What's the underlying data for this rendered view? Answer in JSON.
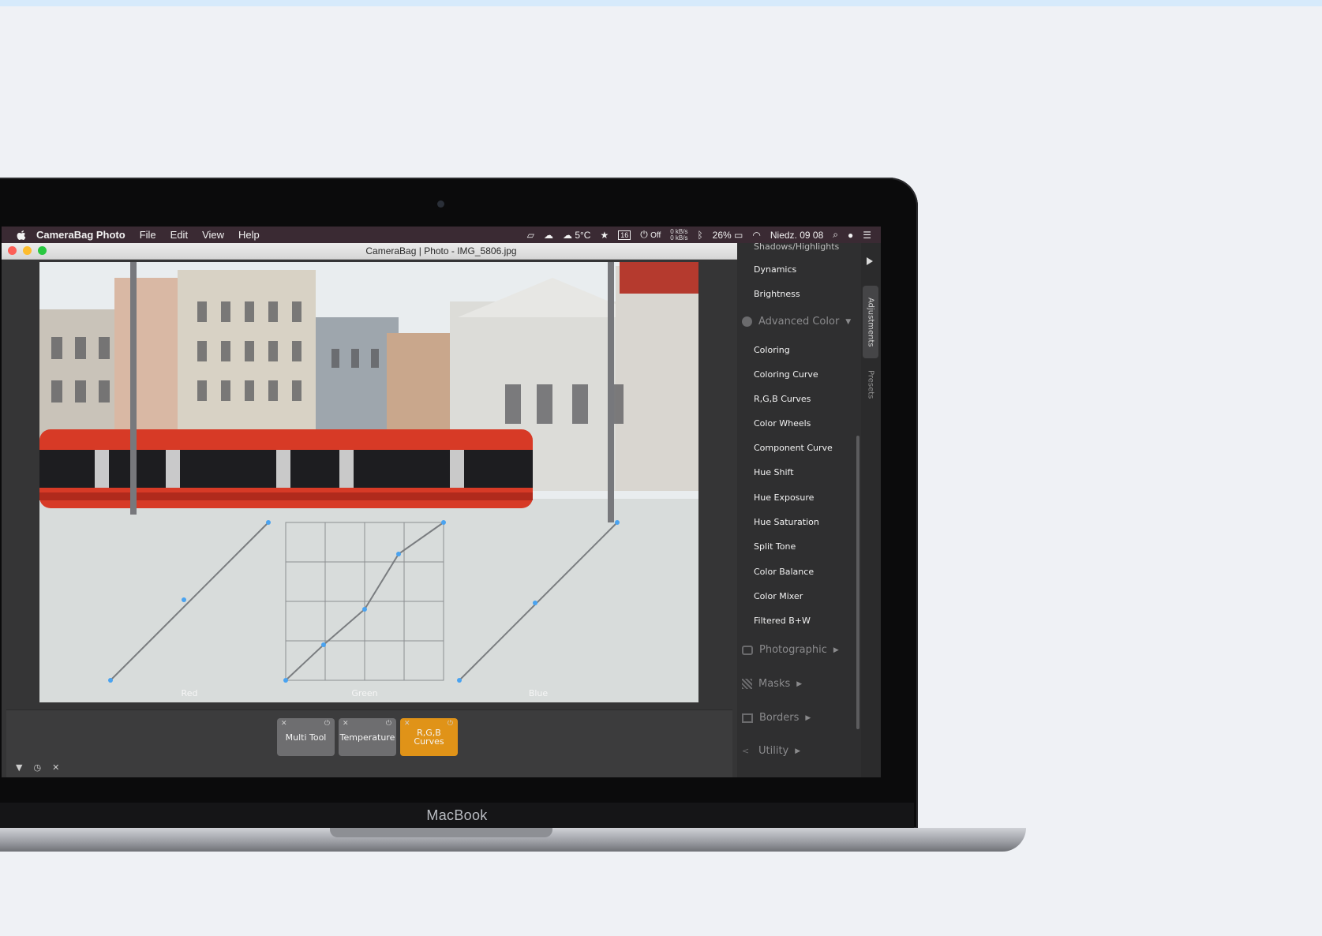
{
  "menubar": {
    "app_name": "CameraBag Photo",
    "menus": [
      "File",
      "Edit",
      "View",
      "Help"
    ],
    "weather": "5°C",
    "calendar_day": "16",
    "do_not_disturb": "Off",
    "net_up": "0 kB/s",
    "net_down": "0 kB/s",
    "battery": "26%",
    "clock": "Niedz. 09 08"
  },
  "window": {
    "title": "CameraBag | Photo - IMG_5806.jpg"
  },
  "curves": {
    "red_label": "Red",
    "green_label": "Green",
    "blue_label": "Blue"
  },
  "dock": {
    "tiles": [
      {
        "label": "Multi Tool"
      },
      {
        "label": "Temperature"
      },
      {
        "label": "R,G,B Curves"
      }
    ],
    "active_color": "#e09318"
  },
  "sidebar": {
    "top_partial": "Shadows/Highlights",
    "items_top": [
      "Dynamics",
      "Brightness"
    ],
    "advanced_color": "Advanced Color",
    "advanced_items": [
      "Coloring",
      "Coloring Curve",
      "R,G,B Curves",
      "Color Wheels",
      "Component Curve",
      "Hue Shift",
      "Hue Exposure",
      "Hue Saturation",
      "Split Tone",
      "Color Balance",
      "Color Mixer",
      "Filtered B+W"
    ],
    "photographic": "Photographic",
    "masks": "Masks",
    "borders": "Borders",
    "utility": "Utility",
    "tabs": {
      "adjustments": "Adjustments",
      "presets": "Presets"
    }
  },
  "device": {
    "brand": "MacBook"
  }
}
